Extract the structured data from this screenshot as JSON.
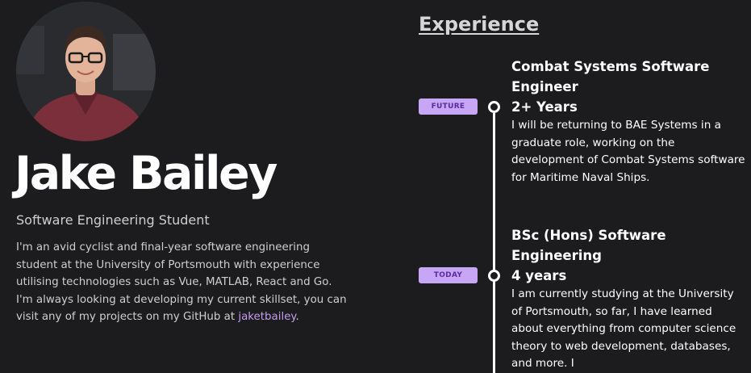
{
  "profile": {
    "name": "Jake Bailey",
    "subtitle": "Software Engineering Student",
    "bio": "I'm an avid cyclist and final-year software engineering student at the University of Portsmouth with experience utilising technologies such as Vue, MATLAB, React and Go. I'm always looking at developing my current skillset, you can visit any of my projects on my GitHub at ",
    "github_link": "jaketbailey",
    "bio_end": "."
  },
  "experience": {
    "heading": "Experience",
    "entries": [
      {
        "badge": "FUTURE",
        "title": "Combat Systems Software Engineer",
        "duration": "2+ Years",
        "description": "I will be returning to BAE Systems in a graduate role, working on the development of Combat Systems software for Maritime Naval Ships."
      },
      {
        "badge": "TODAY",
        "title": "BSc (Hons) Software Engineering",
        "duration": "4 years",
        "description": "I am currently studying at the University of Portsmouth, so far, I have learned about everything from computer science theory to web development, databases, and more. I"
      }
    ]
  },
  "colors": {
    "background": "#1c1b1d",
    "accent": "#c7a6f6",
    "badge_text": "#5a2aa0",
    "link": "#c49cf0"
  }
}
